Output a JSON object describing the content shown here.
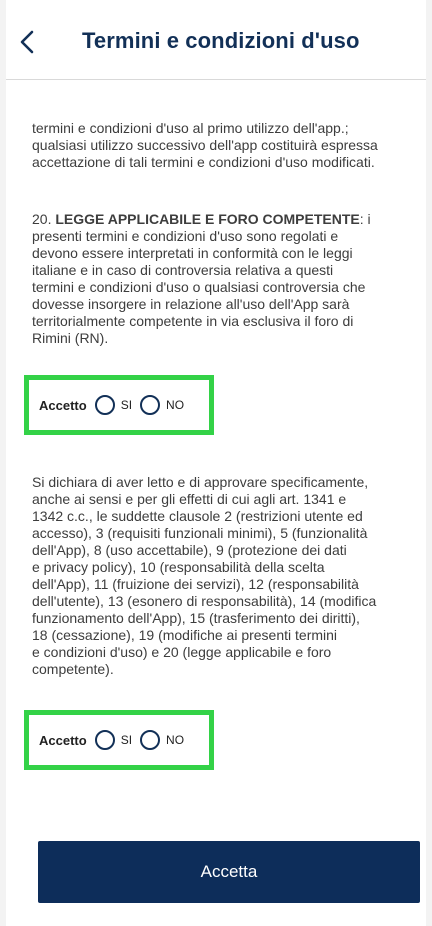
{
  "header": {
    "title": "Termini e condizioni d'uso"
  },
  "content": {
    "para1": "termini e condizioni d'uso al primo utilizzo dell'app.;\nqualsiasi utilizzo successivo dell'app costituirà espressa\naccettazione di tali termini e condizioni d'uso modificati.",
    "para2_number": "20. ",
    "para2_bold": "LEGGE APPLICABILE E FORO COMPETENTE",
    "para2_rest": ": i\npresenti termini e condizioni d'uso sono regolati e\ndevono essere interpretati in conformità con le leggi\nitaliane e in caso di controversia relativa a questi\ntermini e condizioni d'uso o qualsiasi controversia che\ndovesse insorgere in relazione all'uso dell'App sarà\nterritorialmente competente in via esclusiva il foro di\nRimini (RN).",
    "para3": "Si dichiara di aver letto e di approvare specificamente,\nanche ai sensi e per gli effetti di cui agli art. 1341 e\n1342 c.c., le suddette clausole 2 (restrizioni utente ed\naccesso), 3 (requisiti funzionali minimi), 5 (funzionalità\ndell'App), 8 (uso accettabile), 9 (protezione dei dati\ne privacy policy), 10 (responsabilità della scelta\ndell'App), 11 (fruizione dei servizi), 12 (responsabilità\ndell'utente), 13 (esonero di responsabilità), 14 (modifica\nfunzionamento dell'App), 15 (trasferimento dei diritti),\n18 (cessazione), 19 (modifiche ai presenti termini\ne condizioni d'uso) e 20 (legge applicabile e foro\ncompetente)."
  },
  "consent1": {
    "label": "Accetto",
    "yes": "SI",
    "no": "NO"
  },
  "consent2": {
    "label": "Accetto",
    "yes": "SI",
    "no": "NO"
  },
  "footer": {
    "button_label": "Accetta"
  },
  "colors": {
    "brand": "#0d2d5a",
    "highlight": "#33d247"
  },
  "icons": {
    "back": "chevron-left-icon"
  }
}
